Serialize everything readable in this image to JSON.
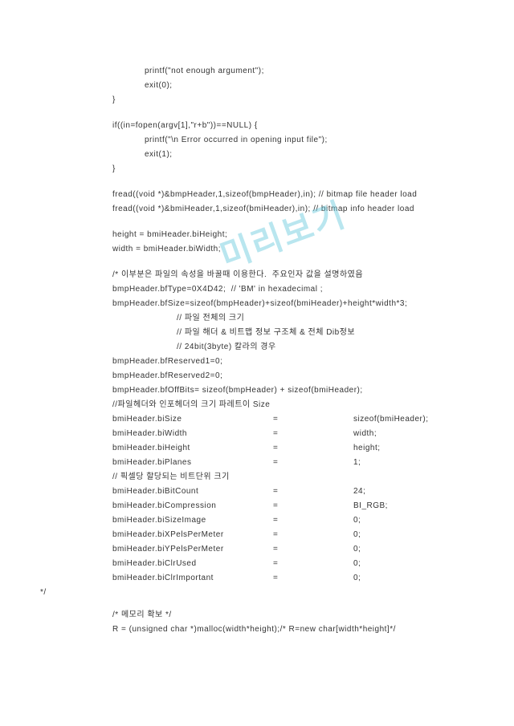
{
  "watermark": "미리보기",
  "lines": [
    {
      "cls": "indent2",
      "text": "printf(\"not enough argument\");"
    },
    {
      "cls": "indent2",
      "text": "exit(0);"
    },
    {
      "cls": "indent1",
      "text": "}"
    },
    {
      "cls": "blank",
      "text": ""
    },
    {
      "cls": "indent1",
      "text": "if((in=fopen(argv[1],\"r+b\"))==NULL) {"
    },
    {
      "cls": "indent2",
      "text": "printf(\"\\n Error occurred in opening input file\");"
    },
    {
      "cls": "indent2",
      "text": "exit(1);"
    },
    {
      "cls": "indent1",
      "text": "}"
    },
    {
      "cls": "blank",
      "text": ""
    },
    {
      "cls": "indent1",
      "text": "fread((void *)&bmpHeader,1,sizeof(bmpHeader),in); // bitmap file header load"
    },
    {
      "cls": "indent1",
      "text": "fread((void *)&bmiHeader,1,sizeof(bmiHeader),in); // bitmap info header load"
    },
    {
      "cls": "blank",
      "text": ""
    },
    {
      "cls": "indent1",
      "text": "height = bmiHeader.biHeight;"
    },
    {
      "cls": "indent1",
      "text": "width = bmiHeader.biWidth;"
    },
    {
      "cls": "blank",
      "text": ""
    },
    {
      "cls": "indent1",
      "text": "/* 이부분은 파일의 속성을 바꿀때 이용한다.  주요인자 값을 설명하였음"
    },
    {
      "cls": "indent1",
      "text": "bmpHeader.bfType=0X4D42;  // 'BM' in hexadecimal ;"
    },
    {
      "cls": "indent1",
      "text": "bmpHeader.bfSize=sizeof(bmpHeader)+sizeof(bmiHeader)+height*width*3;"
    },
    {
      "cls": "indent3",
      "text": "// 파일 전체의 크기"
    },
    {
      "cls": "indent3",
      "text": "// 파일 해더 & 비트맵 정보 구조체 & 전체 Dib정보"
    },
    {
      "cls": "indent3",
      "text": "// 24bit(3byte) 칼라의 경우"
    },
    {
      "cls": "indent1",
      "text": "bmpHeader.bfReserved1=0;"
    },
    {
      "cls": "indent1",
      "text": "bmpHeader.bfReserved2=0;"
    },
    {
      "cls": "indent1",
      "text": "bmpHeader.bfOffBits= sizeof(bmpHeader) + sizeof(bmiHeader);"
    },
    {
      "cls": "indent1",
      "text": "//파일헤더와 인포헤더의 크기 파레트이 Size"
    }
  ],
  "table": [
    {
      "c1": "bmiHeader.biSize",
      "c2": "=",
      "c3": "sizeof(bmiHeader);"
    },
    {
      "c1": "bmiHeader.biWidth",
      "c2": "=",
      "c3": "width;"
    },
    {
      "c1": "bmiHeader.biHeight",
      "c2": "=",
      "c3": "height;"
    },
    {
      "c1": "bmiHeader.biPlanes",
      "c2": "=",
      "c3": "1;"
    }
  ],
  "comment1": "// 픽셀당 할당되는 비트단위 크기",
  "table2": [
    {
      "c1": "bmiHeader.biBitCount",
      "c2": "=",
      "c3": "24;"
    },
    {
      "c1": "bmiHeader.biCompression",
      "c2": "=",
      "c3": "BI_RGB;"
    },
    {
      "c1": "bmiHeader.biSizeImage",
      "c2": "=",
      "c3": "0;"
    },
    {
      "c1": "bmiHeader.biXPelsPerMeter",
      "c2": "=",
      "c3": "0;"
    },
    {
      "c1": "bmiHeader.biYPelsPerMeter",
      "c2": "=",
      "c3": "0;"
    },
    {
      "c1": "bmiHeader.biClrUsed",
      "c2": "=",
      "c3": "0;"
    },
    {
      "c1": "bmiHeader.biClrImportant",
      "c2": "=",
      "c3": "0;"
    }
  ],
  "closeComment": "*/",
  "footer": [
    {
      "cls": "indent1",
      "text": "/* 메모리 확보 */"
    },
    {
      "cls": "indent1",
      "text": "R = (unsigned char *)malloc(width*height);/* R=new char[width*height]*/"
    }
  ]
}
